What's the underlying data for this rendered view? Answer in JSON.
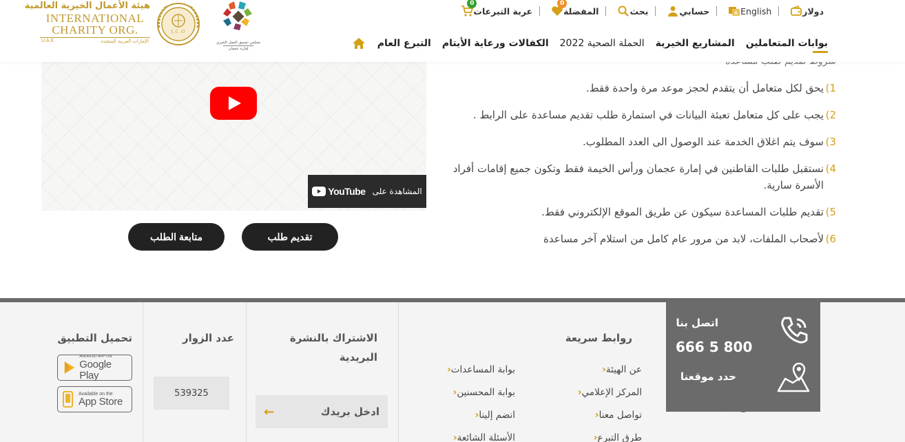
{
  "header": {
    "topbar": {
      "cart_label": "عربة التبرعات",
      "cart_count": "0",
      "favorites_label": "المفضلة",
      "favorites_count": "0",
      "search_label": "بحث",
      "account_label": "حسابي",
      "language_label": "English",
      "currency_label": "دولار"
    },
    "nav": [
      "التبرع العام",
      "الكفالات ورعاية الأيتام",
      "الحملة الصحية 2022",
      "المشاريع الخيرية",
      "بوابات المتعاملين"
    ],
    "logo": {
      "org_ar": "هيئة الأعمال الخيرية العالمية",
      "org_en_1": "INTERNATIONAL",
      "org_en_2": "CHARITY ORG.",
      "country_en": "U.A.E",
      "country_ar": "الإمارات العربية المتحدة",
      "seal_letters": "I.C.O",
      "council_line1": "مجلس تنسيق العمل الخيري",
      "council_line2": "إمارة عجمان"
    }
  },
  "video": {
    "watch_on": "المشاهدة على",
    "youtube": "YouTube"
  },
  "actions": {
    "submit": "تقديم طلب",
    "track": "متابعة الطلب"
  },
  "conditions": {
    "title": "شروط تقديم طلب مساعدة",
    "items": [
      {
        "num": "1)",
        "text": "يحق لكل متعامل أن يتقدم لحجز موعد مرة واحدة فقط."
      },
      {
        "num": "2)",
        "text": "يجب على كل متعامل تعبئة البيانات في  استمارة طلب تقديم مساعدة على الرابط ."
      },
      {
        "num": "3)",
        "text": "سوف يتم اغلاق الخدمة عند الوصول الى العدد المطلوب."
      },
      {
        "num": "4)",
        "text": "نستقبل طلبات القاطنين في إمارة عجمان ورأس الخيمة فقط وتكون جميع إقامات أفراد الأسرة سارية."
      },
      {
        "num": "5)",
        "text": "تقديم طلبات المساعدة سيكون عن طريق الموقع الإلكتروني فقط."
      },
      {
        "num": "6)",
        "text": "لأصحاب الملفات، لابد من مرور عام كامل من استلام آخر مساعدة"
      }
    ]
  },
  "footer": {
    "contact": {
      "title": "اتصل بنا",
      "phone": "800 5 666",
      "locate": "حدد موقعنا"
    },
    "quick_links": {
      "title": "روابط سريعة",
      "col1": [
        "عن الهيئة",
        "المركز الإعلامي",
        "تواصل معنا",
        "طرق التبرع"
      ],
      "col2": [
        "بوابة المساعدات",
        "بوابة المحسنين",
        "انضم إلينا",
        "الأسئلة الشائعة"
      ]
    },
    "newsletter": {
      "title": "الاشتراك بالنشرة البريدية",
      "placeholder": "ادخل بريدك"
    },
    "visitors": {
      "title": "عدد الزوار",
      "count": "539325"
    },
    "app": {
      "title": "تحميل التطبيق",
      "google_small": "ANDROID APP ON",
      "google_big": "Google Play",
      "apple_small": "Available on the",
      "apple_big": "App Store"
    }
  },
  "colors": {
    "accent_gold": "#d4a017",
    "dark": "#222222",
    "footer_gray": "#6b6b6b"
  }
}
